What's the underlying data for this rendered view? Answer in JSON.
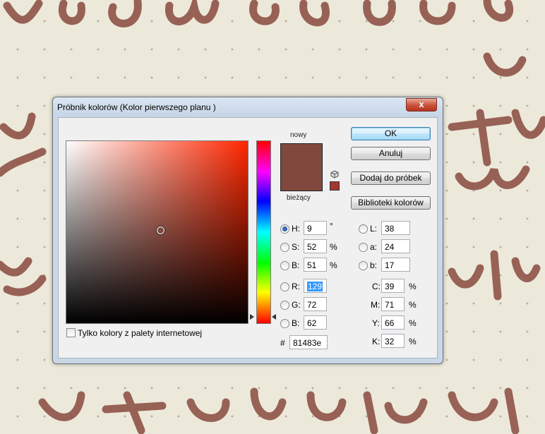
{
  "window": {
    "title": "Próbnik kolorów (Kolor pierwszego planu )",
    "close_glyph": "x"
  },
  "swatches": {
    "new_label": "nowy",
    "current_label": "bieżący",
    "current_color": "#81483e",
    "web_color": "#a13830"
  },
  "buttons": {
    "ok": "OK",
    "cancel": "Anuluj",
    "add_to_swatches": "Dodaj do próbek",
    "color_libraries": "Biblioteki kolorów"
  },
  "hsb": {
    "h": {
      "label": "H:",
      "value": "9",
      "unit": "°",
      "selected": true
    },
    "s": {
      "label": "S:",
      "value": "52",
      "unit": "%"
    },
    "b": {
      "label": "B:",
      "value": "51",
      "unit": "%"
    }
  },
  "rgb": {
    "r": {
      "label": "R:",
      "value": "129"
    },
    "g": {
      "label": "G:",
      "value": "72"
    },
    "b": {
      "label": "B:",
      "value": "62"
    }
  },
  "lab": {
    "l": {
      "label": "L:",
      "value": "38"
    },
    "a": {
      "label": "a:",
      "value": "24"
    },
    "b": {
      "label": "b:",
      "value": "17"
    }
  },
  "cmyk": {
    "c": {
      "label": "C:",
      "value": "39",
      "unit": "%"
    },
    "m": {
      "label": "M:",
      "value": "71",
      "unit": "%"
    },
    "y": {
      "label": "Y:",
      "value": "66",
      "unit": "%"
    },
    "k": {
      "label": "K:",
      "value": "32",
      "unit": "%"
    }
  },
  "hex": {
    "label": "#",
    "value": "81483e"
  },
  "web_only": {
    "label": "Tylko kolory z palety internetowej",
    "checked": false
  }
}
